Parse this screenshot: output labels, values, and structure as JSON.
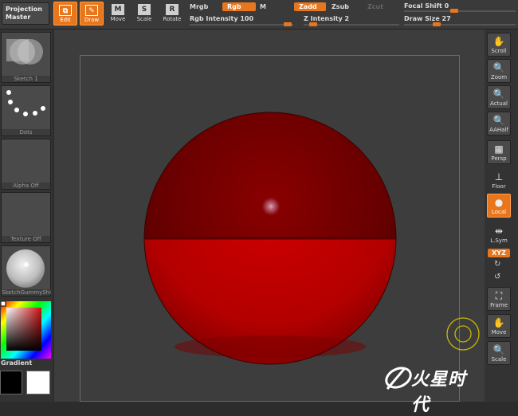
{
  "toolbar": {
    "projection_master_line1": "Projection",
    "projection_master_line2": "Master",
    "tools": [
      {
        "label": "Edit",
        "icon": "edit-icon",
        "glyph": "⧉"
      },
      {
        "label": "Draw",
        "icon": "draw-icon",
        "glyph": "✎"
      },
      {
        "label": "Move",
        "icon": "move-icon",
        "glyph": "M"
      },
      {
        "label": "Scale",
        "icon": "scale-icon",
        "glyph": "S"
      },
      {
        "label": "Rotate",
        "icon": "rotate-icon",
        "glyph": "R"
      }
    ],
    "mrgb": "Mrgb",
    "rgb": "Rgb",
    "m": "M",
    "zadd": "Zadd",
    "zsub": "Zsub",
    "zcut": "Zcut",
    "rgb_intensity_label": "Rgb Intensity",
    "rgb_intensity_value": "100",
    "z_intensity_label": "Z Intensity",
    "z_intensity_value": "2",
    "focal_shift_label": "Focal Shift",
    "focal_shift_value": "0",
    "draw_size_label": "Draw Size",
    "draw_size_value": "27",
    "accent": "#e8761c"
  },
  "left_panel": {
    "sketch": "Sketch 1",
    "dots": "Dots",
    "alpha": "Alpha Off",
    "texture": "Texture Off",
    "material": "SketchGummyShi",
    "gradient": "Gradient"
  },
  "right_panel": {
    "buttons": [
      {
        "label": "Scroll",
        "icon": "hand-icon",
        "glyph": "✋"
      },
      {
        "label": "Zoom",
        "icon": "zoom-icon",
        "glyph": "🔍"
      },
      {
        "label": "Actual",
        "icon": "actual-icon",
        "glyph": "🔍"
      },
      {
        "label": "AAHalf",
        "icon": "aahalf-icon",
        "glyph": "🔍"
      },
      {
        "label": "Persp",
        "icon": "persp-icon",
        "glyph": "▦"
      },
      {
        "label": "Floor",
        "icon": "floor-icon",
        "glyph": "⊥"
      },
      {
        "label": "Local",
        "icon": "local-icon",
        "glyph": "●"
      },
      {
        "label": "L.Sym",
        "icon": "lsym-icon",
        "glyph": "⇹"
      }
    ],
    "xyz": "XYZ",
    "frame": "Frame",
    "move": "Move",
    "scale": "Scale"
  },
  "watermark": "火星时代"
}
